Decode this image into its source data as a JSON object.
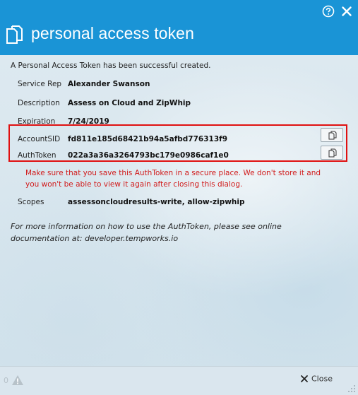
{
  "header": {
    "title": "personal access token"
  },
  "intro": "A Personal Access Token has been successful created.",
  "fields": {
    "service_rep": {
      "label": "Service Rep",
      "value": "Alexander Swanson"
    },
    "description": {
      "label": "Description",
      "value": "Assess on Cloud and ZipWhip"
    },
    "expiration": {
      "label": "Expiration",
      "value": "7/24/2019"
    },
    "account_sid": {
      "label": "AccountSID",
      "value": "fd811e185d68421b94a5afbd776313f9"
    },
    "auth_token": {
      "label": "AuthToken",
      "value": "022a3a36a3264793bc179e0986caf1e0"
    },
    "scopes": {
      "label": "Scopes",
      "value": "assessoncloudresults-write, allow-zipwhip"
    }
  },
  "warning": "Make sure that you save this AuthToken in a secure place. We don't store it and you won't be able to view it again after closing this dialog.",
  "info": "For more information on how to use the AuthToken, please see online documentation at: developer.tempworks.io",
  "footer": {
    "warning_count": "0",
    "close_label": "Close"
  },
  "colors": {
    "header": "#1a94d6",
    "highlight": "#e01010",
    "warning_text": "#d11c1c"
  }
}
